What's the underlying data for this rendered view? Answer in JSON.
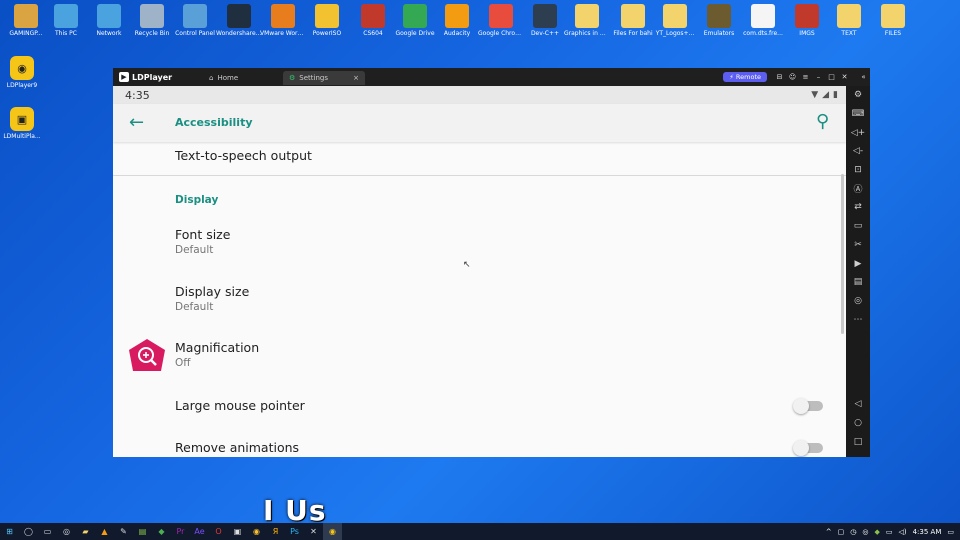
{
  "desktop": {
    "icons": [
      {
        "label": "GAMINGP...",
        "icon": "user-folder-icon",
        "color": "#d9a441"
      },
      {
        "label": "This PC",
        "icon": "computer-icon",
        "color": "#4aa3df"
      },
      {
        "label": "Network",
        "icon": "network-icon",
        "color": "#4aa3df"
      },
      {
        "label": "Recycle Bin",
        "icon": "recycle-bin-icon",
        "color": "#9fb3c8"
      },
      {
        "label": "Control Panel",
        "icon": "control-panel-icon",
        "color": "#5aa0d8"
      },
      {
        "label": "Wondershare Filmora 12",
        "icon": "filmora-icon",
        "color": "#1f2f3f"
      },
      {
        "label": "VMware Workstati...",
        "icon": "vmware-icon",
        "color": "#e87d1e"
      },
      {
        "label": "PowerISO",
        "icon": "poweriso-icon",
        "color": "#f2c230"
      },
      {
        "label": "CS604",
        "icon": "book-icon",
        "color": "#c0392b"
      },
      {
        "label": "Google Drive",
        "icon": "google-drive-icon",
        "color": "#34a853"
      },
      {
        "label": "Audacity",
        "icon": "audacity-icon",
        "color": "#f39c12"
      },
      {
        "label": "Google Chrome",
        "icon": "chrome-icon",
        "color": "#e74c3c"
      },
      {
        "label": "Dev-C++",
        "icon": "dev-cpp-icon",
        "color": "#2c3e50"
      },
      {
        "label": "Graphics in Dev C++",
        "icon": "file-icon",
        "color": "#f3d36b"
      },
      {
        "label": "Files For bahi",
        "icon": "folder-icon",
        "color": "#f3d36b"
      },
      {
        "label": "YT_Logos+...",
        "icon": "folder-icon",
        "color": "#f3d36b"
      },
      {
        "label": "Emulators",
        "icon": "folder-icon",
        "color": "#6b5b2e"
      },
      {
        "label": "com.dts.fre...",
        "icon": "file-icon",
        "color": "#f5f5f5"
      },
      {
        "label": "IMGS",
        "icon": "folder-icon",
        "color": "#c0392b"
      },
      {
        "label": "TEXT",
        "icon": "folder-icon",
        "color": "#f3d36b"
      },
      {
        "label": "FILES",
        "icon": "folder-icon",
        "color": "#f3d36b"
      }
    ],
    "side_icons": [
      {
        "label": "LDPlayer9",
        "icon": "ldplayer-icon"
      },
      {
        "label": "LDMultiPla...",
        "icon": "ldmultiplayer-icon"
      }
    ]
  },
  "ldplayer": {
    "brand": "LDPlayer",
    "tabs": [
      {
        "label": "Home",
        "icon": "home-icon"
      },
      {
        "label": "Settings",
        "icon": "settings-icon",
        "close": "×"
      }
    ],
    "remote_label": "Remote",
    "window_controls": [
      "gamepad-icon",
      "account-icon",
      "menu-icon",
      "minimize-icon",
      "maximize-icon",
      "close-icon",
      "collapse-icon"
    ],
    "sidebar_tools": [
      "settings-icon",
      "keyboard-icon",
      "volume-up-icon",
      "volume-down-icon",
      "screenshot-icon",
      "install-apk-icon",
      "sync-icon",
      "fps-icon",
      "scissors-icon",
      "video-icon",
      "operation-record-icon",
      "shake-icon",
      "more-icon"
    ],
    "nav_buttons": [
      "back-icon",
      "home-circle-icon",
      "recents-icon"
    ]
  },
  "android": {
    "status_time": "4:35",
    "toolbar_title": "Accessibility",
    "items": {
      "tts": {
        "title": "Text-to-speech output"
      },
      "display_header": "Display",
      "font_size": {
        "title": "Font size",
        "subtitle": "Default"
      },
      "display_size": {
        "title": "Display size",
        "subtitle": "Default"
      },
      "magnification": {
        "title": "Magnification",
        "subtitle": "Off"
      },
      "large_pointer": {
        "title": "Large mouse pointer",
        "enabled": false
      },
      "remove_animations": {
        "title": "Remove animations",
        "enabled": false
      }
    },
    "accent_color": "#1a8f82",
    "magnification_icon_color": "#d81b60"
  },
  "caption": "I Us",
  "taskbar": {
    "clock": "4:35 AM"
  }
}
